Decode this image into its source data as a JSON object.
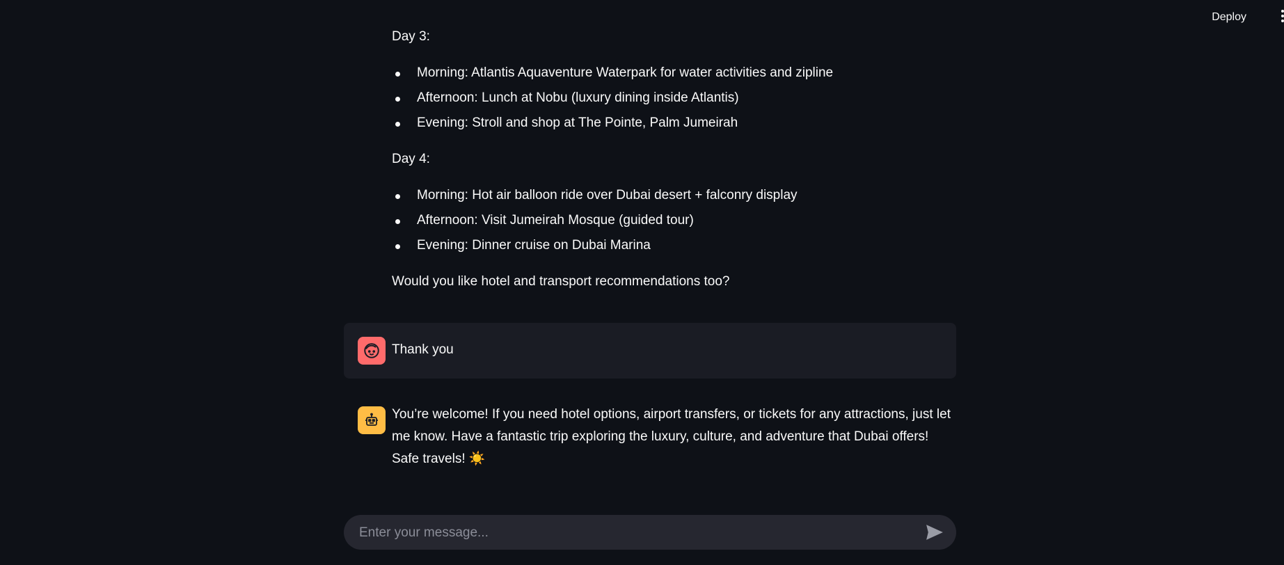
{
  "header": {
    "deploy_label": "Deploy",
    "menu_icon": "more-vertical-icon"
  },
  "assistant_itinerary": {
    "day3": {
      "label": "Day 3:",
      "items": [
        "Morning: Atlantis Aquaventure Waterpark for water activities and zipline",
        "Afternoon: Lunch at Nobu (luxury dining inside Atlantis)",
        "Evening: Stroll and shop at The Pointe, Palm Jumeirah"
      ]
    },
    "day4": {
      "label": "Day 4:",
      "items": [
        "Morning: Hot air balloon ride over Dubai desert + falconry display",
        "Afternoon: Visit Jumeirah Mosque (guided tour)",
        "Evening: Dinner cruise on Dubai Marina"
      ]
    },
    "closing": "Would you like hotel and transport recommendations too?"
  },
  "user_message": {
    "avatar_icon": "user-face-icon",
    "avatar_color": "#ff6b6b",
    "text": "Thank you"
  },
  "assistant_message": {
    "avatar_icon": "robot-icon",
    "avatar_color": "#ffbd45",
    "text": "You’re welcome! If you need hotel options, airport transfers, or tickets for any attractions, just let me know. Have a fantastic trip exploring the luxury, culture, and adventure that Dubai offers! Safe travels! ☀️"
  },
  "chat_input": {
    "placeholder": "Enter your message...",
    "value": "",
    "send_icon": "send-icon"
  },
  "colors": {
    "background": "#0e1117",
    "user_bubble": "#1a1c24",
    "input_bg": "#262730",
    "text": "#fafafa"
  }
}
